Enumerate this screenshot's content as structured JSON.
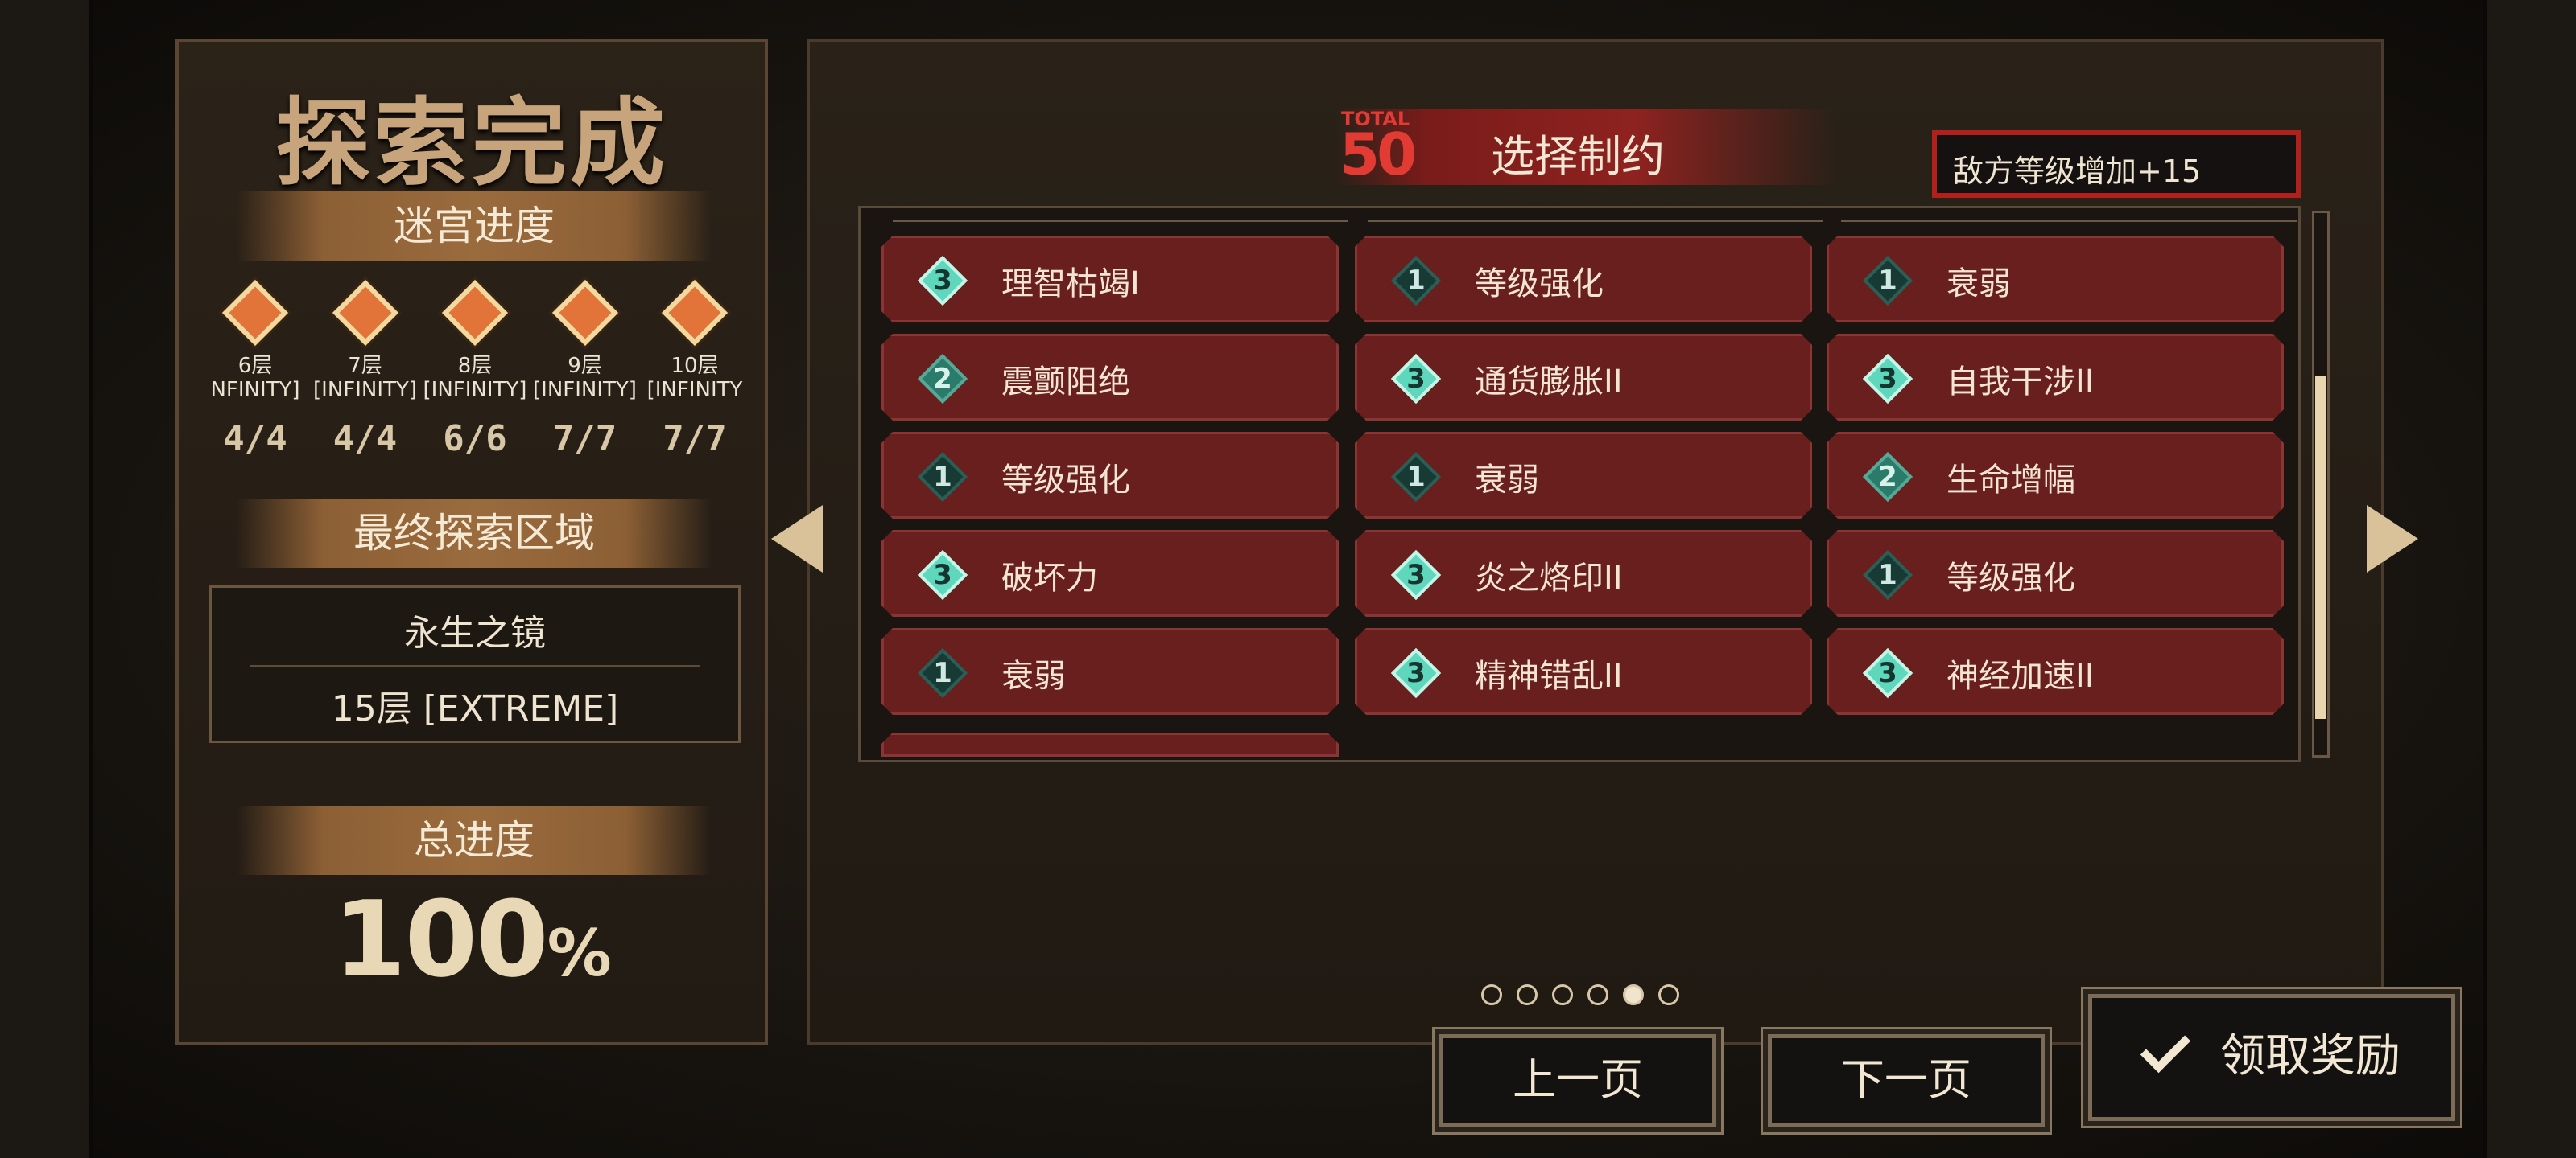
{
  "left_panel": {
    "title": "探索完成",
    "labyrinth_progress_label": "迷宫进度",
    "floors": [
      {
        "name": "6层",
        "mode": "NFINITY]",
        "count": "4/4"
      },
      {
        "name": "7层",
        "mode": "[INFINITY]",
        "count": "4/4"
      },
      {
        "name": "8层",
        "mode": "[INFINITY]",
        "count": "6/6"
      },
      {
        "name": "9层",
        "mode": "[INFINITY]",
        "count": "7/7"
      },
      {
        "name": "10层",
        "mode": "[INFINITY",
        "count": "7/7"
      }
    ],
    "final_area_label": "最终探索区域",
    "final_area_name": "永生之镜",
    "final_area_floor": "15层 [EXTREME]",
    "total_progress_label": "总进度",
    "total_progress_value": "100",
    "total_progress_unit": "%"
  },
  "main_panel": {
    "total_label": "TOTAL",
    "total_value": "50",
    "header_title": "选择制约",
    "current_constraint": "敌方等级增加+15",
    "tiles": [
      [
        {
          "level": "3",
          "label": "理智枯竭I"
        },
        {
          "level": "1",
          "label": "等级强化"
        },
        {
          "level": "1",
          "label": "衰弱"
        }
      ],
      [
        {
          "level": "2",
          "label": "震颤阻绝"
        },
        {
          "level": "3",
          "label": "通货膨胀II"
        },
        {
          "level": "3",
          "label": "自我干涉II"
        }
      ],
      [
        {
          "level": "1",
          "label": "等级强化"
        },
        {
          "level": "1",
          "label": "衰弱"
        },
        {
          "level": "2",
          "label": "生命增幅"
        }
      ],
      [
        {
          "level": "3",
          "label": "破坏力"
        },
        {
          "level": "3",
          "label": "炎之烙印II"
        },
        {
          "level": "1",
          "label": "等级强化"
        }
      ],
      [
        {
          "level": "1",
          "label": "衰弱"
        },
        {
          "level": "3",
          "label": "精神错乱II"
        },
        {
          "level": "3",
          "label": "神经加速II"
        }
      ]
    ],
    "page_dots": {
      "total": 6,
      "active_index": 4
    },
    "prev_button": "上一页",
    "next_button": "下一页",
    "claim_button": "领取奖励"
  }
}
